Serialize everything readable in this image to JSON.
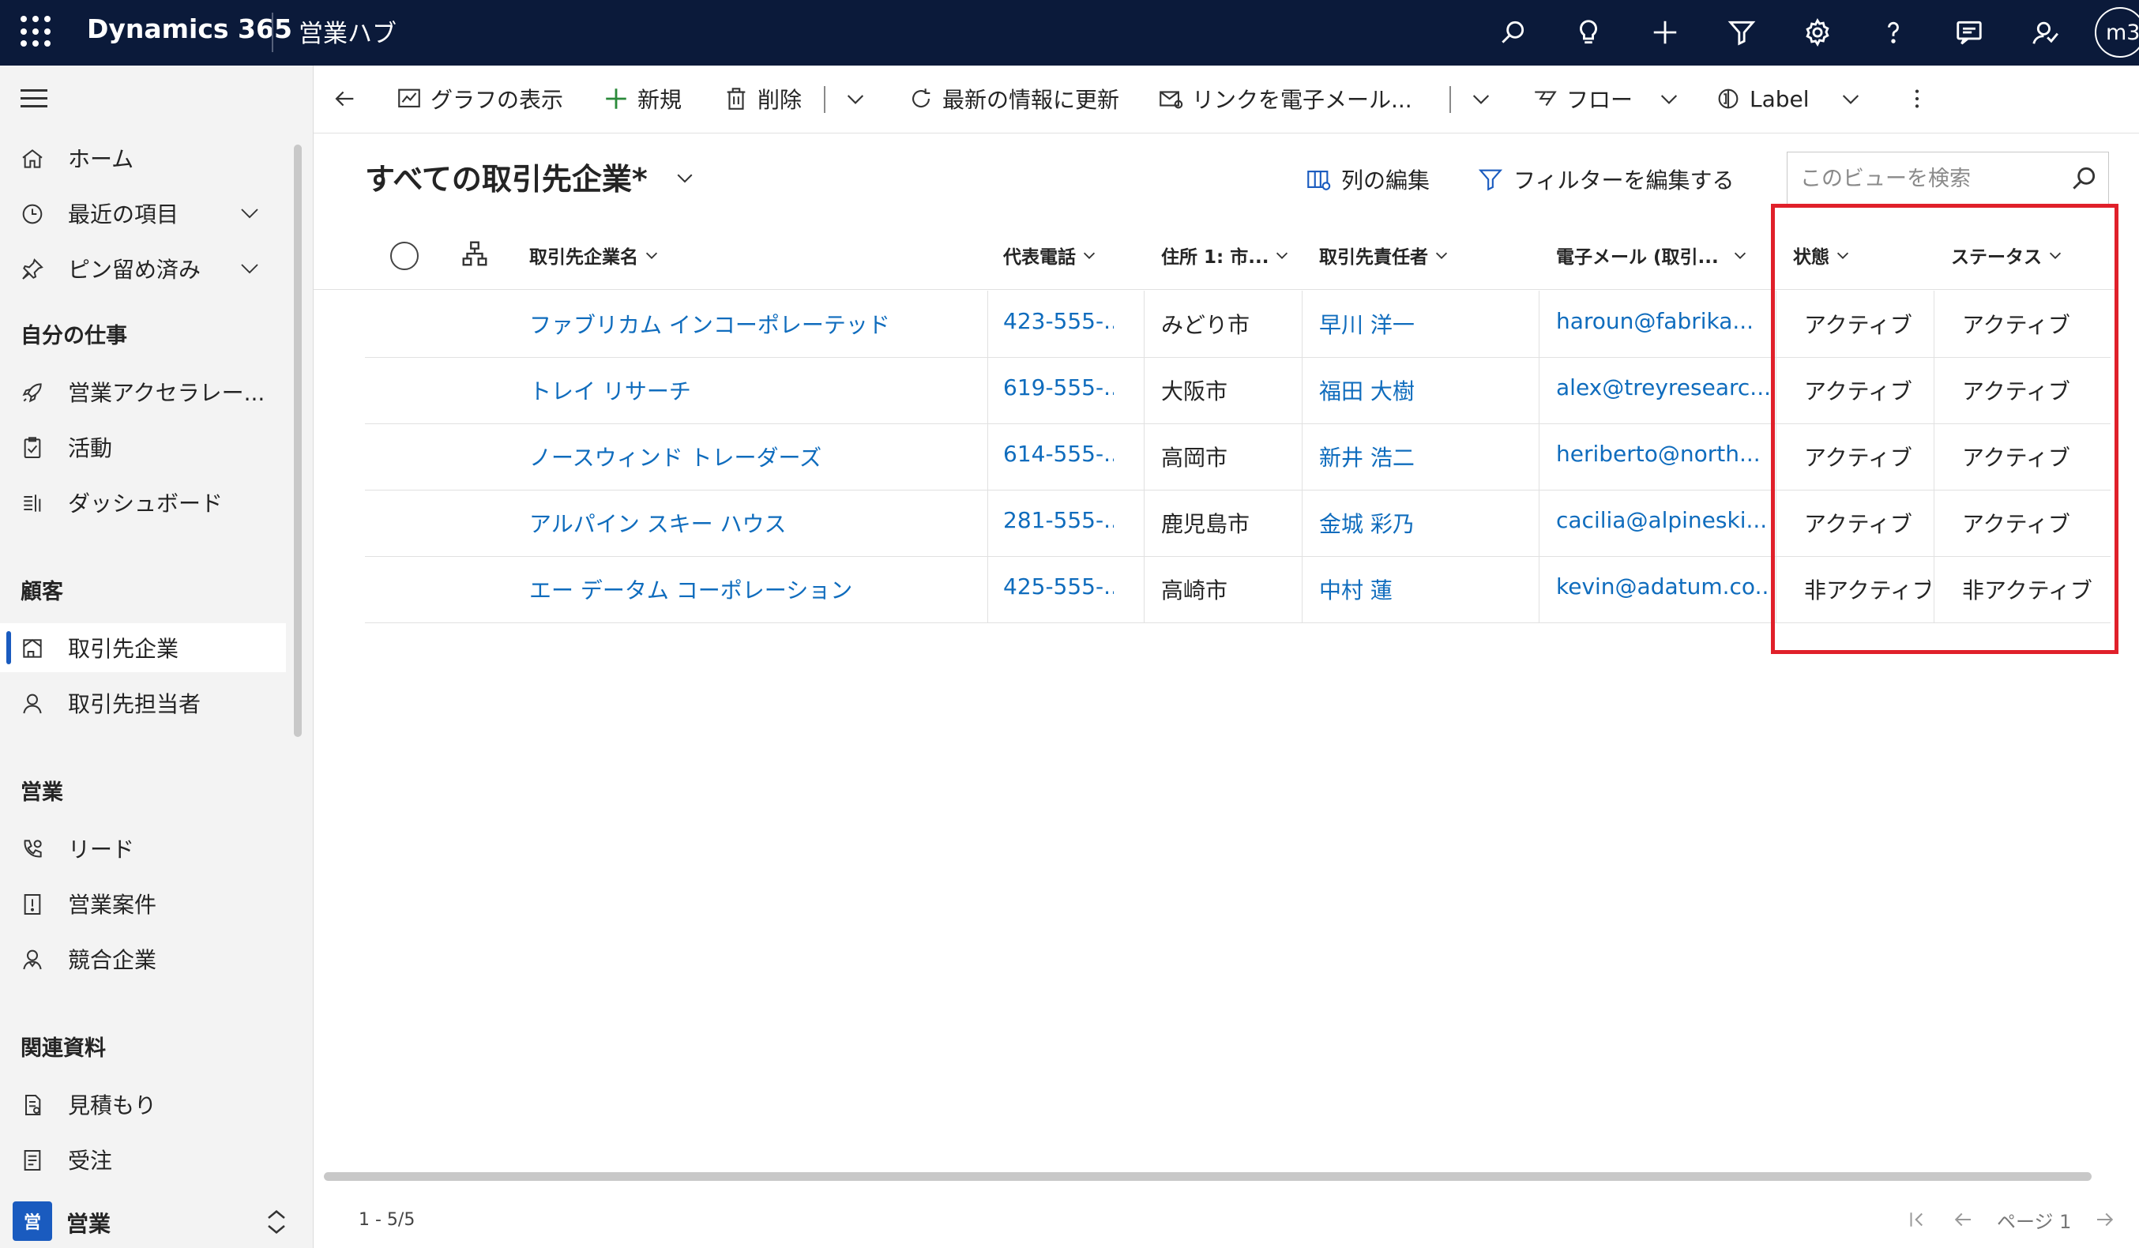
{
  "topbar": {
    "app_name": "Dynamics 365",
    "hub_name": "営業ハブ",
    "avatar_initials": "m3",
    "icons": [
      "search-icon",
      "lightbulb-icon",
      "plus-icon",
      "filter-icon",
      "settings-icon",
      "help-icon",
      "chat-icon",
      "feedback-icon"
    ]
  },
  "sidebar": {
    "items": [
      {
        "label": "ホーム",
        "icon": "home-icon"
      },
      {
        "label": "最近の項目",
        "icon": "clock-icon"
      },
      {
        "label": "ピン留め済み",
        "icon": "pin-icon"
      },
      {
        "label": "営業アクセラレー...",
        "icon": "rocket-icon"
      },
      {
        "label": "活動",
        "icon": "clipboard-icon"
      },
      {
        "label": "ダッシュボード",
        "icon": "dashboard-icon"
      },
      {
        "label": "取引先企業",
        "icon": "building-icon"
      },
      {
        "label": "取引先担当者",
        "icon": "person-icon"
      },
      {
        "label": "リード",
        "icon": "phone-icon"
      },
      {
        "label": "営業案件",
        "icon": "opportunity-icon"
      },
      {
        "label": "競合企業",
        "icon": "competitor-icon"
      },
      {
        "label": "見積もり",
        "icon": "quote-icon"
      },
      {
        "label": "受注",
        "icon": "order-icon"
      }
    ],
    "sections": {
      "my_work": "自分の仕事",
      "customers": "顧客",
      "sales": "営業",
      "collateral": "関連資料"
    },
    "area": {
      "badge": "営",
      "label": "営業"
    }
  },
  "commandbar": {
    "show_chart": "グラフの表示",
    "new": "新規",
    "delete": "削除",
    "refresh": "最新の情報に更新",
    "email_link": "リンクを電子メール...",
    "flow": "フロー",
    "label": "Label"
  },
  "view": {
    "title": "すべての取引先企業*",
    "edit_columns": "列の編集",
    "edit_filters": "フィルターを編集する",
    "search_placeholder": "このビューを検索"
  },
  "grid": {
    "columns": [
      "取引先企業名",
      "代表電話",
      "住所 1: 市...",
      "取引先責任者",
      "電子メール (取引...",
      "状態",
      "ステータス"
    ],
    "rows": [
      {
        "name": "ファブリカム インコーポレーテッド",
        "phone": "423-555-...",
        "city": "みどり市",
        "contact": "早川 洋一",
        "email": "haroun@fabrika...",
        "state": "アクティブ",
        "status": "アクティブ"
      },
      {
        "name": "トレイ リサーチ",
        "phone": "619-555-...",
        "city": "大阪市",
        "contact": "福田 大樹",
        "email": "alex@treyresearc...",
        "state": "アクティブ",
        "status": "アクティブ"
      },
      {
        "name": "ノースウィンド トレーダーズ",
        "phone": "614-555-...",
        "city": "高岡市",
        "contact": "新井 浩二",
        "email": "heriberto@north...",
        "state": "アクティブ",
        "status": "アクティブ"
      },
      {
        "name": "アルパイン スキー ハウス",
        "phone": "281-555-...",
        "city": "鹿児島市",
        "contact": "金城 彩乃",
        "email": "cacilia@alpineski...",
        "state": "アクティブ",
        "status": "アクティブ"
      },
      {
        "name": "エー データム コーポレーション",
        "phone": "425-555-...",
        "city": "高崎市",
        "contact": "中村 蓮",
        "email": "kevin@adatum.co...",
        "state": "非アクティブ",
        "status": "非アクティブ"
      }
    ]
  },
  "footer": {
    "record_count": "1 - 5/5",
    "page_label": "ページ 1"
  },
  "colors": {
    "topbar": "#0b1a3a",
    "link": "#0f6cbd",
    "highlight": "#e0202a",
    "accent": "#1a5bbf"
  }
}
